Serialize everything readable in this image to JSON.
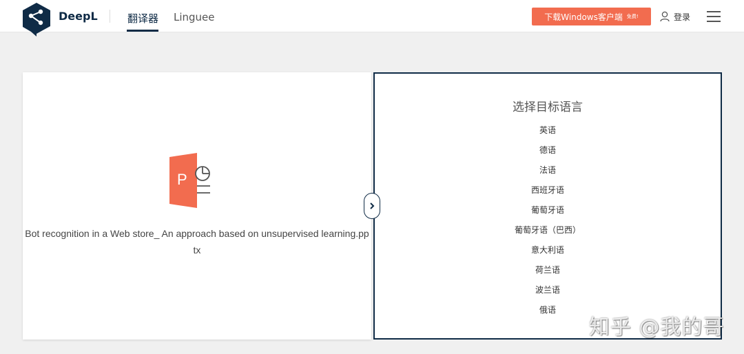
{
  "header": {
    "brand": "DeepL",
    "tabs": [
      {
        "label": "翻译器",
        "active": true
      },
      {
        "label": "Linguee",
        "active": false
      }
    ],
    "download_label": "下载Windows客户端",
    "download_badge": "免费!",
    "login_label": "登录"
  },
  "source": {
    "file_icon": "powerpoint-file-icon",
    "file_icon_letter": "P",
    "filename_line1": "Bot recognition in a Web store_ An approach based on unsupervised learning.pp",
    "filename_line2": "tx"
  },
  "target": {
    "title": "选择目标语言",
    "languages": [
      "英语",
      "德语",
      "法语",
      "西班牙语",
      "葡萄牙语",
      "葡萄牙语（巴西）",
      "意大利语",
      "荷兰语",
      "波兰语",
      "俄语"
    ]
  },
  "watermark": "知乎 @我的哥",
  "colors": {
    "brand_navy": "#0f2b46",
    "download_orange": "#f26c4f",
    "powerpoint_orange": "#f26c4f"
  }
}
